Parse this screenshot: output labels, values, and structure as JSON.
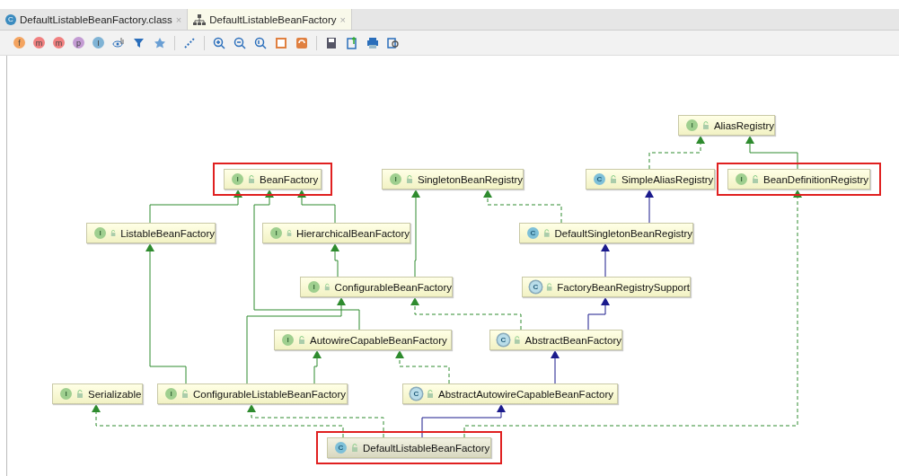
{
  "tabs": [
    {
      "label": "DefaultListableBeanFactory.class",
      "kind": "class",
      "badge": "C",
      "close": "×",
      "selected": false
    },
    {
      "label": "DefaultListableBeanFactory",
      "kind": "diagram",
      "close": "×",
      "selected": true
    }
  ],
  "toolbar_filters": [
    {
      "label": "f",
      "color": "#f4a460"
    },
    {
      "label": "m",
      "color": "#f08080"
    },
    {
      "label": "m",
      "color": "#f08080"
    },
    {
      "label": "p",
      "color": "#c39bd3"
    },
    {
      "label": "I",
      "color": "#7fb3d5"
    }
  ],
  "nodes": [
    {
      "name": "AliasRegistry",
      "kind": "interface",
      "badge": "I",
      "highlighted": false,
      "selected": false
    },
    {
      "name": "BeanFactory",
      "kind": "interface",
      "badge": "I",
      "highlighted": true,
      "selected": false
    },
    {
      "name": "SingletonBeanRegistry",
      "kind": "interface",
      "badge": "I",
      "highlighted": false,
      "selected": false
    },
    {
      "name": "SimpleAliasRegistry",
      "kind": "class",
      "badge": "C",
      "highlighted": false,
      "selected": false
    },
    {
      "name": "BeanDefinitionRegistry",
      "kind": "interface",
      "badge": "I",
      "highlighted": true,
      "selected": false
    },
    {
      "name": "ListableBeanFactory",
      "kind": "interface",
      "badge": "I",
      "highlighted": false,
      "selected": false
    },
    {
      "name": "HierarchicalBeanFactory",
      "kind": "interface",
      "badge": "I",
      "highlighted": false,
      "selected": false
    },
    {
      "name": "DefaultSingletonBeanRegistry",
      "kind": "class",
      "badge": "C",
      "highlighted": false,
      "selected": false
    },
    {
      "name": "ConfigurableBeanFactory",
      "kind": "interface",
      "badge": "I",
      "highlighted": false,
      "selected": false
    },
    {
      "name": "FactoryBeanRegistrySupport",
      "kind": "abstract",
      "badge": "C",
      "highlighted": false,
      "selected": false
    },
    {
      "name": "AutowireCapableBeanFactory",
      "kind": "interface",
      "badge": "I",
      "highlighted": false,
      "selected": false
    },
    {
      "name": "AbstractBeanFactory",
      "kind": "abstract",
      "badge": "C",
      "highlighted": false,
      "selected": false
    },
    {
      "name": "Serializable",
      "kind": "interface",
      "badge": "I",
      "highlighted": false,
      "selected": false
    },
    {
      "name": "ConfigurableListableBeanFactory",
      "kind": "interface",
      "badge": "I",
      "highlighted": false,
      "selected": false
    },
    {
      "name": "AbstractAutowireCapableBeanFactory",
      "kind": "abstract",
      "badge": "C",
      "highlighted": false,
      "selected": false
    },
    {
      "name": "DefaultListableBeanFactory",
      "kind": "class",
      "badge": "C",
      "highlighted": true,
      "selected": true
    }
  ],
  "edges": [
    {
      "kind": "implements"
    },
    {
      "kind": "extends"
    },
    {
      "kind": "extends"
    },
    {
      "kind": "extends"
    },
    {
      "kind": "extends"
    },
    {
      "kind": "extends"
    },
    {
      "kind": "extends"
    },
    {
      "kind": "implements"
    },
    {
      "kind": "class-extends"
    },
    {
      "kind": "class-extends"
    },
    {
      "kind": "class-extends"
    },
    {
      "kind": "implements"
    },
    {
      "kind": "extends"
    },
    {
      "kind": "extends"
    },
    {
      "kind": "extends"
    },
    {
      "kind": "implements"
    },
    {
      "kind": "class-extends"
    },
    {
      "kind": "implements"
    },
    {
      "kind": "implements"
    },
    {
      "kind": "class-extends"
    },
    {
      "kind": "implements"
    }
  ]
}
